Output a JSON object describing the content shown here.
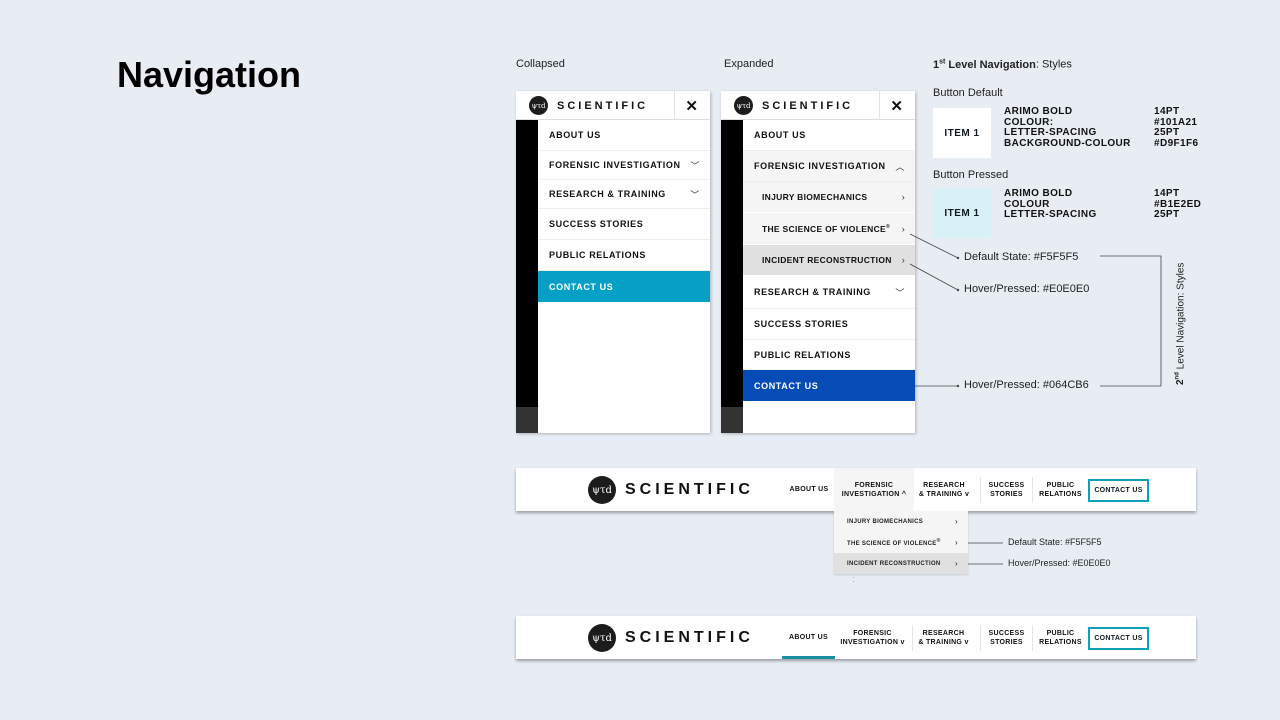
{
  "page": {
    "title": "Navigation"
  },
  "captions": {
    "collapsed": "Collapsed",
    "expanded": "Expanded",
    "first_level_bold": "1",
    "first_level_sup": "st",
    "first_level_rest_bold": " Level Navigation",
    "first_level_tail": ": Styles"
  },
  "brand": {
    "logo_glyph": "ψτd",
    "name": "SCIENTIFIC"
  },
  "icons": {
    "close": "✕",
    "chevron_down": "⌄",
    "chevron_up": "⌃",
    "chevron_right": "›"
  },
  "mobile_collapsed": {
    "items": [
      {
        "label": "ABOUT US",
        "chevron": ""
      },
      {
        "label": "FORENSIC INVESTIGATION",
        "chevron": "down"
      },
      {
        "label": "RESEARCH & TRAINING",
        "chevron": "down"
      },
      {
        "label": "SUCCESS STORIES",
        "chevron": ""
      },
      {
        "label": "PUBLIC RELATIONS",
        "chevron": ""
      },
      {
        "label": "CONTACT US",
        "chevron": "",
        "bg": "#06a0c6"
      }
    ]
  },
  "mobile_expanded": {
    "items": [
      {
        "label": "ABOUT US"
      },
      {
        "label": "FORENSIC INVESTIGATION",
        "expanded": true
      },
      {
        "label": "INJURY BIOMECHANICS",
        "sub": true
      },
      {
        "label": "THE SCIENCE OF VIOLENCE",
        "sup": "®",
        "sub": true
      },
      {
        "label": "INCIDENT RECONSTRUCTION",
        "sub": true,
        "hover": true
      },
      {
        "label": "RESEARCH & TRAINING"
      },
      {
        "label": "SUCCESS STORIES"
      },
      {
        "label": "PUBLIC RELATIONS"
      },
      {
        "label": "CONTACT US",
        "bg": "#064cb6"
      }
    ]
  },
  "styles": {
    "button_default": {
      "title": "Button Default",
      "swatch_label": "ITEM 1",
      "swatch_bg": "#ffffff",
      "props": [
        "ARIMO BOLD",
        "COLOUR:",
        "LETTER-SPACING",
        "BACKGROUND-COLOUR"
      ],
      "values": [
        "14PT",
        "#101A21",
        "25PT",
        "#D9F1F6"
      ]
    },
    "button_pressed": {
      "title": "Button Pressed",
      "swatch_label": "ITEM 1",
      "swatch_bg": "#d9f1f6",
      "props": [
        "ARIMO BOLD",
        "COLOUR",
        "LETTER-SPACING"
      ],
      "values": [
        "14PT",
        "#B1E2ED",
        "25PT"
      ]
    },
    "second_level": {
      "title_pre": "2",
      "title_sup": "nd",
      "title_rest": " Level Navigation: Styles",
      "default_state": "Default State: #F5F5F5",
      "hover_pressed_grey": "Hover/Pressed: #E0E0E0",
      "hover_pressed_blue": "Hover/Pressed: #064CB6"
    }
  },
  "desktop_nav": {
    "items": [
      {
        "line1": "ABOUT US",
        "line2": ""
      },
      {
        "line1": "FORENSIC",
        "line2": "INVESTIGATION"
      },
      {
        "line1": "RESEARCH",
        "line2": "& TRAINING"
      },
      {
        "line1": "SUCCESS",
        "line2": "STORIES"
      },
      {
        "line1": "PUBLIC",
        "line2": "RELATIONS"
      }
    ],
    "contact": "CONTACT US",
    "dropdown": [
      {
        "label": "INJURY BIOMECHANICS"
      },
      {
        "label": "THE SCIENCE OF VIOLENCE",
        "sup": "®"
      },
      {
        "label": "INCIDENT RECONSTRUCTION"
      }
    ],
    "dropdown_annotations": {
      "default_state": "Default State: #F5F5F5",
      "hover_pressed": "Hover/Pressed: #E0E0E0"
    }
  }
}
